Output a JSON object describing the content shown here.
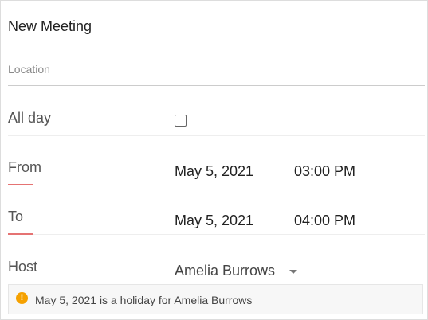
{
  "form": {
    "title": "New Meeting",
    "location_placeholder": "Location",
    "location_value": ""
  },
  "fields": {
    "all_day": {
      "label": "All day",
      "checked": false
    },
    "from": {
      "label": "From",
      "date": "May 5, 2021",
      "time": "03:00 PM"
    },
    "to": {
      "label": "To",
      "date": "May 5, 2021",
      "time": "04:00 PM"
    },
    "host": {
      "label": "Host",
      "value": "Amelia Burrows"
    }
  },
  "warning": {
    "icon": "exclamation-circle-icon",
    "glyph": "!",
    "text": "May 5, 2021 is a holiday for Amelia Burrows"
  },
  "colors": {
    "label_underline": "#e57373",
    "select_underline": "#5fb8c9",
    "warning_icon": "#f5a100"
  }
}
